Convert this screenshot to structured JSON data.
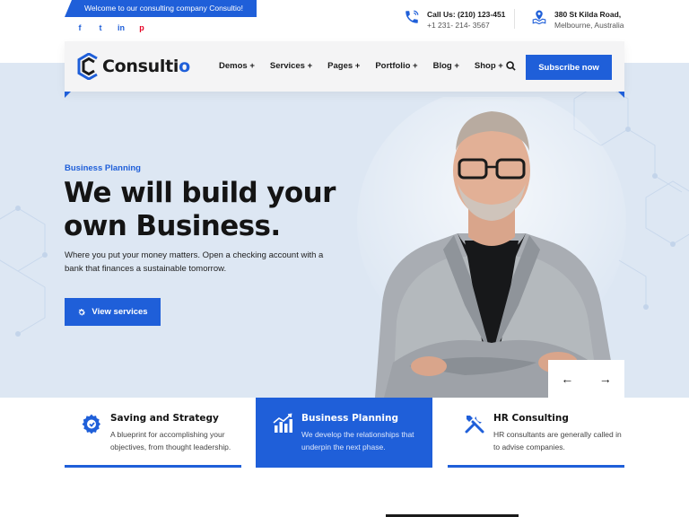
{
  "topbar": {
    "welcome": "Welcome to our consulting company Consultio!",
    "social": [
      {
        "icon": "facebook-icon",
        "glyph": "f"
      },
      {
        "icon": "twitter-icon",
        "glyph": "t"
      },
      {
        "icon": "linkedin-icon",
        "glyph": "in"
      },
      {
        "icon": "pinterest-icon",
        "glyph": "p"
      }
    ],
    "phone_label": "Call Us: (210) 123-451",
    "phone_number": "+1 231- 214- 3567",
    "address_line1": "380 St Kilda Road,",
    "address_line2": "Melbourne, Australia"
  },
  "nav": {
    "logo_main": "Consulti",
    "logo_accent": "o",
    "items": [
      "Demos +",
      "Services +",
      "Pages +",
      "Portfolio +",
      "Blog +",
      "Shop +"
    ],
    "search_icon": "search-icon",
    "subscribe": "Subscribe now"
  },
  "hero": {
    "eyebrow": "Business Planning",
    "headline": "We will build your own Business.",
    "description": "Where you put your money matters. Open a checking account with a bank that finances a sustainable tomorrow.",
    "cta": "View services",
    "cta_icon": "gear-icon"
  },
  "slider": {
    "prev": "←",
    "next": "→"
  },
  "features": [
    {
      "title": "Saving and Strategy",
      "desc": "A blueprint for accomplishing your objectives, from thought leadership.",
      "icon": "strategy-gear-icon",
      "active": false
    },
    {
      "title": "Business Planning",
      "desc": "We develop the relationships that underpin the next phase.",
      "icon": "chart-icon",
      "active": true
    },
    {
      "title": "HR Consulting",
      "desc": "HR consultants are generally called in to advise companies.",
      "icon": "tools-icon",
      "active": false
    }
  ],
  "colors": {
    "accent": "#1f5fd9",
    "hero_bg": "#dde7f3"
  }
}
